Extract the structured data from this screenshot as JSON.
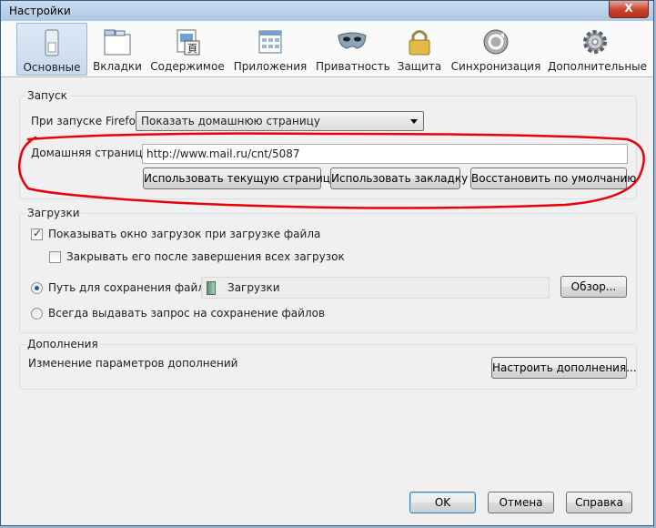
{
  "window": {
    "title": "Настройки",
    "close_label": "X"
  },
  "toolbar": {
    "items": [
      {
        "label": "Основные",
        "icon": "switch-icon",
        "selected": true
      },
      {
        "label": "Вкладки",
        "icon": "tabs-icon"
      },
      {
        "label": "Содержимое",
        "icon": "content-icon"
      },
      {
        "label": "Приложения",
        "icon": "applications-icon"
      },
      {
        "label": "Приватность",
        "icon": "mask-icon"
      },
      {
        "label": "Защита",
        "icon": "lock-icon"
      },
      {
        "label": "Синхронизация",
        "icon": "sync-icon"
      },
      {
        "label": "Дополнительные",
        "icon": "gear-icon"
      }
    ]
  },
  "startup": {
    "group_title": "Запуск",
    "on_start_label": "При запуске Firefox:",
    "on_start_value": "Показать домашнюю страницу",
    "homepage_label": "Домашняя страница:",
    "homepage_value": "http://www.mail.ru/cnt/5087",
    "use_current_button": "Использовать текущую страницу",
    "use_bookmark_button": "Использовать закладку",
    "restore_default_button": "Восстановить по умолчанию"
  },
  "downloads": {
    "group_title": "Загрузки",
    "show_window_label": "Показывать окно загрузок при загрузке файла",
    "show_window_checked": true,
    "close_after_label": "Закрывать его после завершения всех загрузок",
    "close_after_checked": false,
    "save_path_label": "Путь для сохранения файлов",
    "save_path_value": "Загрузки",
    "browse_button": "Обзор...",
    "always_ask_label": "Всегда выдавать запрос на сохранение файлов",
    "selected_option": "save_path"
  },
  "addons": {
    "group_title": "Дополнения",
    "description": "Изменение параметров дополнений",
    "manage_button": "Настроить дополнения..."
  },
  "footer": {
    "ok": "OK",
    "cancel": "Отмена",
    "help": "Справка"
  },
  "colors": {
    "annotation": "#e8000b",
    "accent": "#1d5a9b"
  }
}
